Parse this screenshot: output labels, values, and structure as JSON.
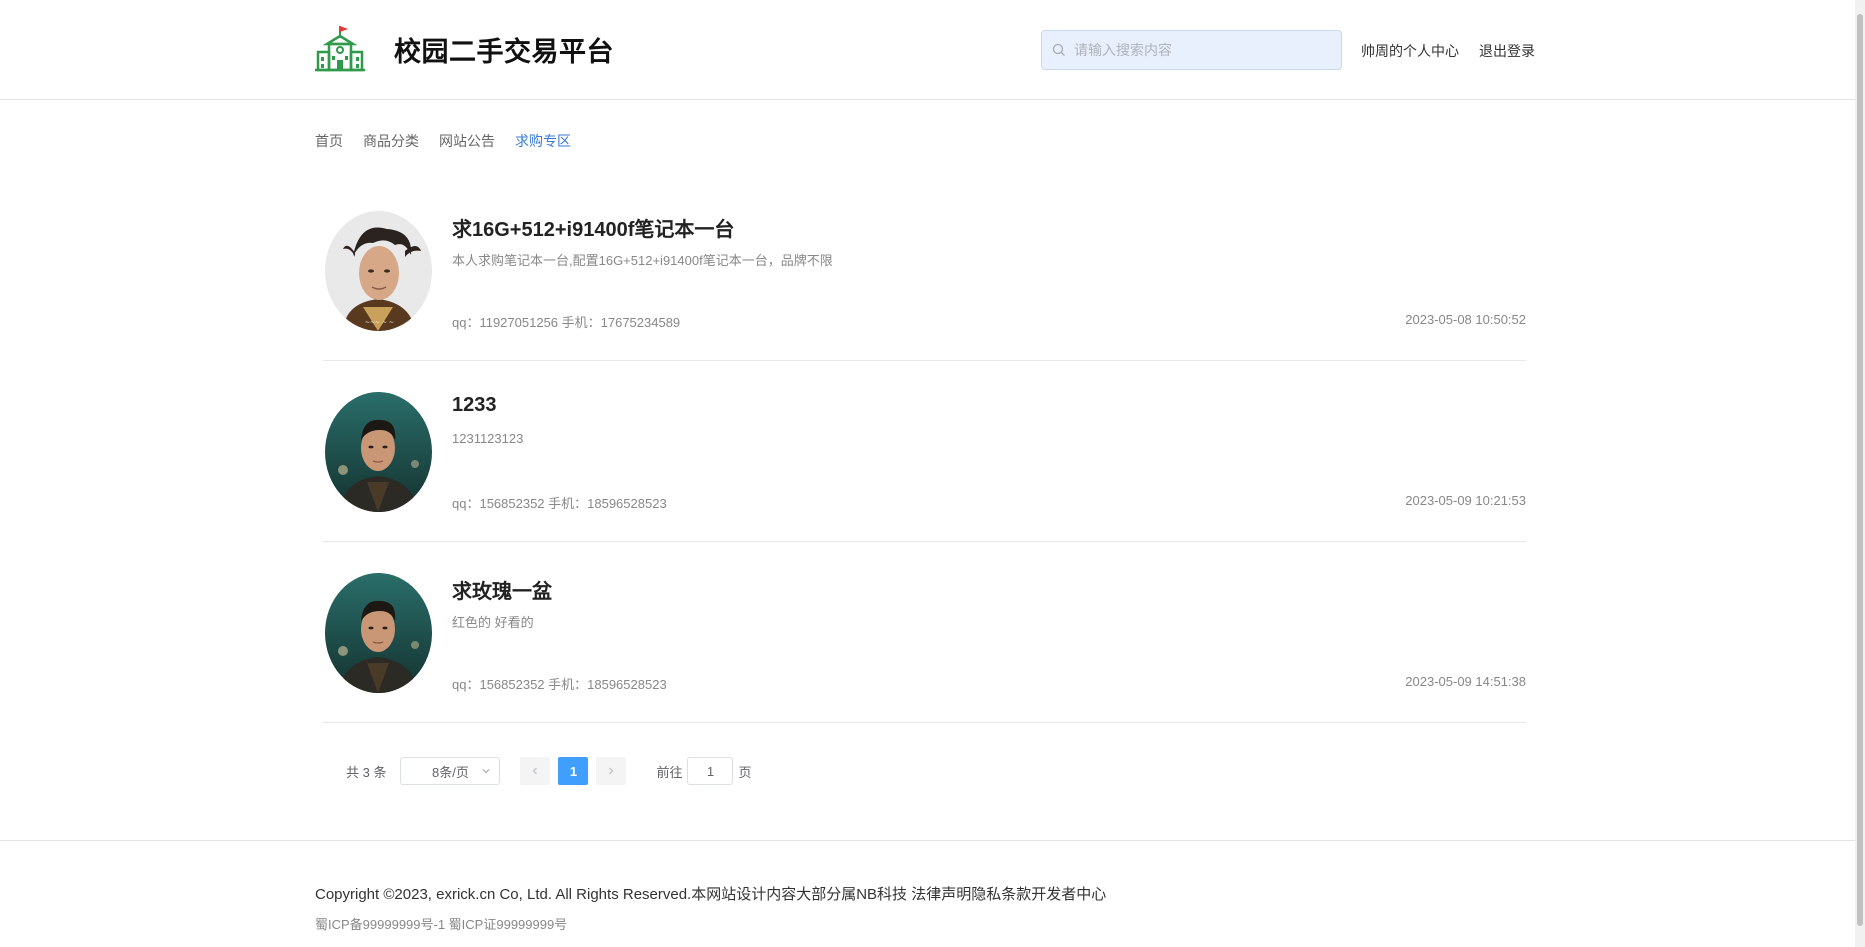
{
  "header": {
    "site_title": "校园二手交易平台",
    "search_placeholder": "请输入搜索内容",
    "user_center": "帅周的个人中心",
    "logout": "退出登录"
  },
  "nav": {
    "items": [
      "首页",
      "商品分类",
      "网站公告",
      "求购专区"
    ],
    "active_index": 3
  },
  "requests": [
    {
      "title": "求16G+512+i91400f笔记本一台",
      "desc": "本人求购笔记本一台,配置16G+512+i91400f笔记本一台，品牌不限",
      "contact": "qq：11927051256 手机：17675234589",
      "time": "2023-05-08 10:50:52",
      "avatar": "avatar-man-longhair"
    },
    {
      "title": "1233",
      "desc": "1231123123",
      "contact": "qq：156852352 手机：18596528523",
      "time": "2023-05-09 10:21:53",
      "avatar": "avatar-man-jacket"
    },
    {
      "title": "求玫瑰一盆",
      "desc": "红色的 好看的",
      "contact": "qq：156852352 手机：18596528523",
      "time": "2023-05-09 14:51:38",
      "avatar": "avatar-man-jacket"
    }
  ],
  "pagination": {
    "total_text": "共 3 条",
    "page_size": "8条/页",
    "current_page": "1",
    "goto_prefix": "前往",
    "goto_value": "1",
    "goto_suffix": "页"
  },
  "footer": {
    "copyright": "Copyright ©2023, exrick.cn Co, Ltd. All Rights Reserved.本网站设计内容大部分属NB科技 法律声明隐私条款开发者中心",
    "icp": "蜀ICP备99999999号-1 蜀ICP证99999999号"
  },
  "colors": {
    "accent": "#409eff",
    "nav_active": "#3a7bd5",
    "logo_green": "#2e9a4a",
    "logo_flag": "#e53935"
  }
}
